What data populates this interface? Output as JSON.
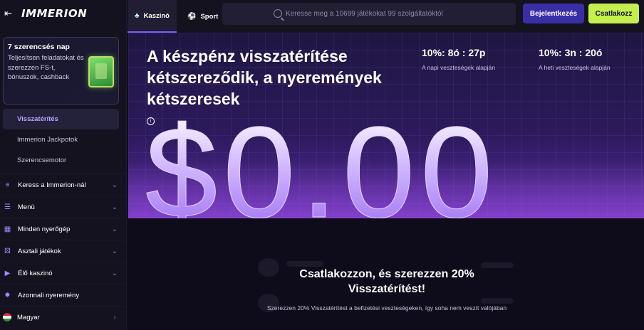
{
  "brand": {
    "name": "IMMERION"
  },
  "promo": {
    "title": "7 szerencsés nap",
    "text": "Teljesítsen feladatokat és szerezzen FS-t, bónuszok, cashback"
  },
  "sub_items": [
    {
      "label": "Visszatérítés",
      "active": true
    },
    {
      "label": "Immerion Jackpotok",
      "active": false
    },
    {
      "label": "Szerencsemotor",
      "active": false
    }
  ],
  "nav_items": [
    {
      "label": "Keress a Immerion-nál",
      "icon": "coins-icon",
      "glyph": "≡",
      "chevron": "⌄"
    },
    {
      "label": "Menü",
      "icon": "menu-icon",
      "glyph": "☰",
      "chevron": "⌄"
    },
    {
      "label": "Minden nyerőgép",
      "icon": "grid-icon",
      "glyph": "▦",
      "chevron": "⌄"
    },
    {
      "label": "Asztali játékok",
      "icon": "dice-icon",
      "glyph": "⚄",
      "chevron": "⌄"
    },
    {
      "label": "Élő kaszinó",
      "icon": "play-icon",
      "glyph": "▶",
      "chevron": "⌄"
    },
    {
      "label": "Azonnali nyeremény",
      "icon": "burst-icon",
      "glyph": "✹",
      "chevron": ""
    },
    {
      "label": "Magyar",
      "icon": "flag-icon",
      "glyph": "●",
      "chevron": "›"
    }
  ],
  "tabs": [
    {
      "label": "Kaszinó",
      "active": true,
      "icon": "casino-icon",
      "glyph": "♣"
    },
    {
      "label": "Sport",
      "active": false,
      "icon": "sport-icon",
      "glyph": "⚽"
    }
  ],
  "search": {
    "placeholder": "Keresse meg a 10699 játékokat 99 szolgáltatóktól"
  },
  "buttons": {
    "login": "Bejelentkezés",
    "join": "Csatlakozz"
  },
  "hero": {
    "title": "A készpénz visszatérítése kétszereződik, a nyeremények kétszeresek",
    "stats": [
      {
        "value": "10%: 8ó : 27p",
        "label": "A napi veszteségek alapján"
      },
      {
        "value": "10%: 3n : 20ó",
        "label": "A heti veszteségek alapján"
      }
    ],
    "amount": "$0.00"
  },
  "join": {
    "title": "Csatlakozzon, és szerezzen 20% Visszatérítést!",
    "subtitle": "Szerezzen 20% Visszatérítést a befizetési veszteségeken, így soha nem veszít valójában"
  },
  "colors": {
    "accent": "#7a5cff",
    "join_button": "#c4f04e",
    "login_button": "#3a2ea6"
  }
}
